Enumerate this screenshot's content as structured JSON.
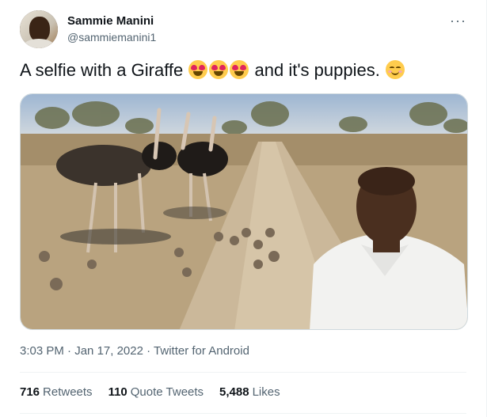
{
  "user": {
    "display_name": "Sammie Manini",
    "handle": "@sammiemanini1"
  },
  "menu_icon": "more-horizontal-icon",
  "tweet": {
    "text_before": "A selfie with a Giraffe",
    "text_after": "and it's puppies.",
    "emojis": [
      "heart-eyes-emoji",
      "heart-eyes-emoji",
      "heart-eyes-emoji",
      "smiling-blush-emoji"
    ]
  },
  "meta": {
    "time": "3:03 PM",
    "sep": "·",
    "date": "Jan 17, 2022",
    "source": "Twitter for Android"
  },
  "stats": {
    "retweets_count": "716",
    "retweets_label": "Retweets",
    "quotes_count": "110",
    "quotes_label": "Quote Tweets",
    "likes_count": "5,488",
    "likes_label": "Likes"
  }
}
